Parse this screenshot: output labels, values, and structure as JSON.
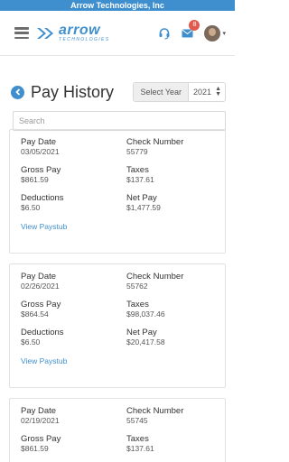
{
  "company": "Arrow Technologies, Inc",
  "logo": {
    "main": "arrow",
    "sub": "TECHNOLOGIES"
  },
  "notifications": {
    "count": "8"
  },
  "page": {
    "title": "Pay History"
  },
  "year_select": {
    "label": "Select Year",
    "value": "2021"
  },
  "search": {
    "placeholder": "Search"
  },
  "labels": {
    "pay_date": "Pay Date",
    "check_number": "Check Number",
    "gross_pay": "Gross Pay",
    "taxes": "Taxes",
    "deductions": "Deductions",
    "net_pay": "Net Pay",
    "view_paystub": "View Paystub"
  },
  "paystubs": [
    {
      "pay_date": "03/05/2021",
      "check_number": "55779",
      "gross_pay": "$861.59",
      "taxes": "$137.61",
      "deductions": "$6.50",
      "net_pay": "$1,477.59"
    },
    {
      "pay_date": "02/26/2021",
      "check_number": "55762",
      "gross_pay": "$864.54",
      "taxes": "$98,037.46",
      "deductions": "$6.50",
      "net_pay": "$20,417.58"
    },
    {
      "pay_date": "02/19/2021",
      "check_number": "55745",
      "gross_pay": "$861.59",
      "taxes": "$137.61"
    }
  ]
}
